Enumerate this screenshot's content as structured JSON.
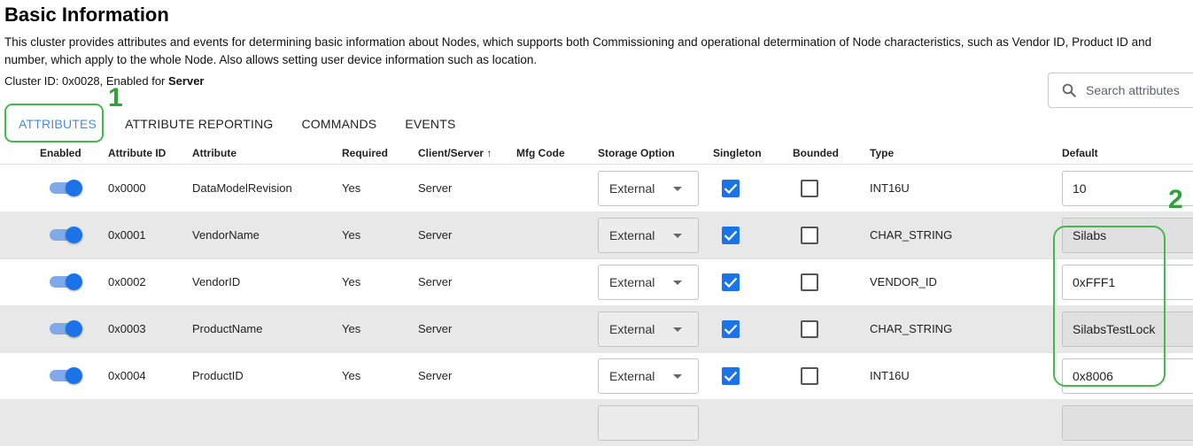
{
  "page": {
    "title": "Basic Information",
    "description_line1": "This cluster provides attributes and events for determining basic information about Nodes, which supports both Commissioning and operational determination of Node characteristics, such as Vendor ID, Product ID and",
    "description_line2": "number, which apply to the whole Node. Also allows setting user device information such as location.",
    "cluster_prefix": "Cluster ID: 0x0028, Enabled for ",
    "cluster_side": "Server"
  },
  "search": {
    "placeholder": "Search attributes",
    "icon": "search-icon"
  },
  "tabs": [
    {
      "label": "ATTRIBUTES",
      "active": true
    },
    {
      "label": "ATTRIBUTE REPORTING"
    },
    {
      "label": "COMMANDS"
    },
    {
      "label": "EVENTS"
    }
  ],
  "annotations": {
    "tabs_number": "1",
    "default_number": "2",
    "color": "#46b84a"
  },
  "table": {
    "headers": {
      "enabled": "Enabled",
      "attribute_id": "Attribute ID",
      "attribute": "Attribute",
      "required": "Required",
      "client_server": "Client/Server ↑",
      "mfg_code": "Mfg Code",
      "storage_option": "Storage Option",
      "singleton": "Singleton",
      "bounded": "Bounded",
      "type": "Type",
      "default": "Default"
    },
    "rows": [
      {
        "enabled": true,
        "id": "0x0000",
        "attribute": "DataModelRevision",
        "required": "Yes",
        "side": "Server",
        "mfg": "",
        "storage": "External",
        "singleton": true,
        "bounded": false,
        "type": "INT16U",
        "default": "10"
      },
      {
        "enabled": true,
        "id": "0x0001",
        "attribute": "VendorName",
        "required": "Yes",
        "side": "Server",
        "mfg": "",
        "storage": "External",
        "singleton": true,
        "bounded": false,
        "type": "CHAR_STRING",
        "default": "Silabs"
      },
      {
        "enabled": true,
        "id": "0x0002",
        "attribute": "VendorID",
        "required": "Yes",
        "side": "Server",
        "mfg": "",
        "storage": "External",
        "singleton": true,
        "bounded": false,
        "type": "VENDOR_ID",
        "default": "0xFFF1"
      },
      {
        "enabled": true,
        "id": "0x0003",
        "attribute": "ProductName",
        "required": "Yes",
        "side": "Server",
        "mfg": "",
        "storage": "External",
        "singleton": true,
        "bounded": false,
        "type": "CHAR_STRING",
        "default": "SilabsTestLock"
      },
      {
        "enabled": true,
        "id": "0x0004",
        "attribute": "ProductID",
        "required": "Yes",
        "side": "Server",
        "mfg": "",
        "storage": "External",
        "singleton": true,
        "bounded": false,
        "type": "INT16U",
        "default": "0x8006"
      }
    ]
  },
  "colors": {
    "accent": "#1a73e8",
    "active_tab": "#4a8cdb",
    "alt_row": "#e8e8e8"
  }
}
